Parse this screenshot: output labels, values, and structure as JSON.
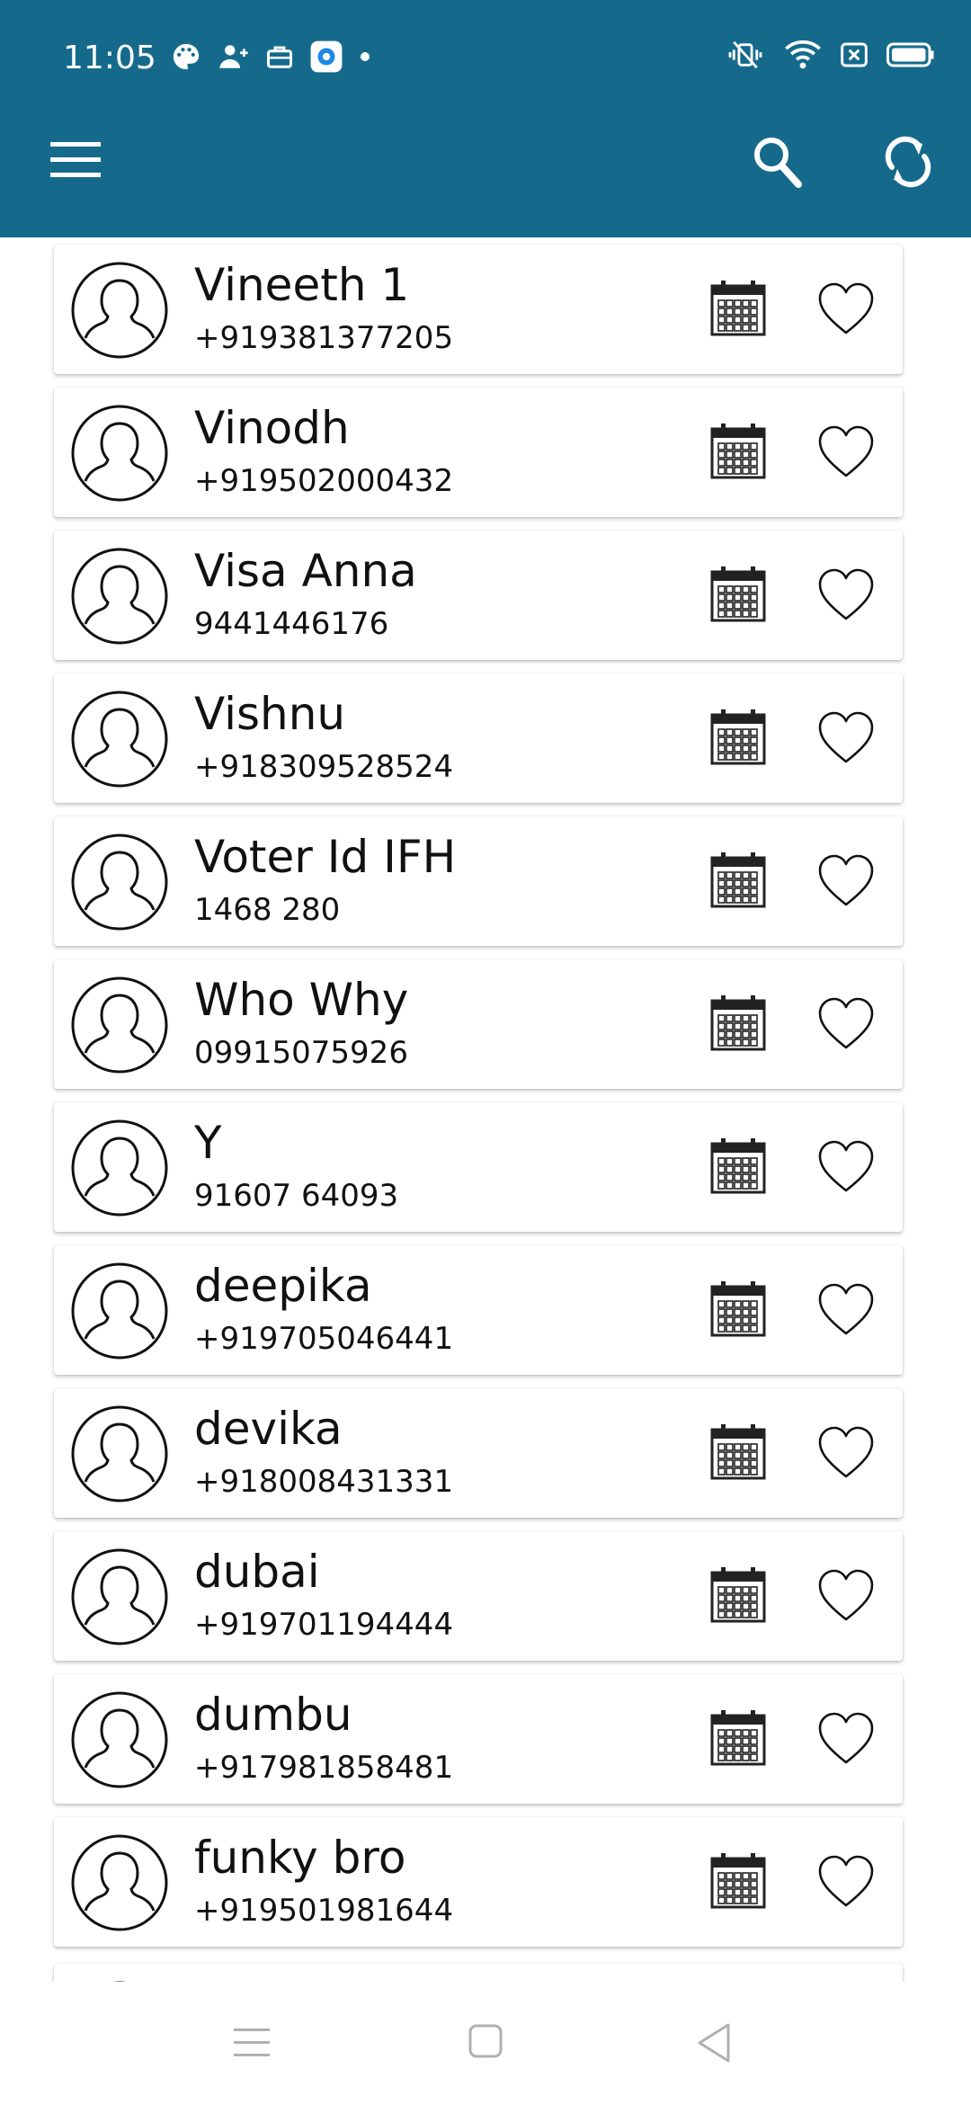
{
  "status_bar": {
    "time": "11:05"
  },
  "toolbar": {
    "menu_icon": "menu-icon",
    "search_icon": "search-icon",
    "sync_icon": "sync-icon"
  },
  "contacts": [
    {
      "name": "Vineeth 1",
      "phone": "+919381377205"
    },
    {
      "name": "Vinodh",
      "phone": "+919502000432"
    },
    {
      "name": "Visa Anna",
      "phone": "9441446176"
    },
    {
      "name": "Vishnu",
      "phone": "+918309528524"
    },
    {
      "name": "Voter Id IFH",
      "phone": "1468 280"
    },
    {
      "name": "Who Why",
      "phone": "09915075926"
    },
    {
      "name": "Y",
      "phone": "91607 64093"
    },
    {
      "name": "deepika",
      "phone": "+919705046441"
    },
    {
      "name": "devika",
      "phone": "+918008431331"
    },
    {
      "name": "dubai",
      "phone": "+919701194444"
    },
    {
      "name": "dumbu",
      "phone": "+917981858481"
    },
    {
      "name": "funky bro",
      "phone": "+919501981644"
    }
  ],
  "colors": {
    "appbar": "#156a8c"
  }
}
